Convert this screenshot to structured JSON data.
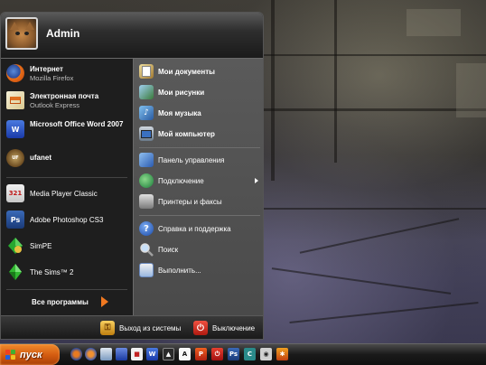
{
  "user": {
    "name": "Admin"
  },
  "pinned": [
    {
      "id": "internet",
      "title": "Интернет",
      "subtitle": "Mozilla Firefox",
      "icon": "firefox-icon"
    },
    {
      "id": "email",
      "title": "Электронная почта",
      "subtitle": "Outlook Express",
      "icon": "outlook-icon"
    },
    {
      "id": "word",
      "title": "Microsoft Office Word 2007",
      "icon": "word-icon"
    },
    {
      "id": "ufanet",
      "title": "ufanet",
      "icon": "ufanet-icon"
    }
  ],
  "recent": [
    {
      "id": "mpc",
      "title": "Media Player Classic",
      "icon": "media-player-icon",
      "badge": "321"
    },
    {
      "id": "photoshop",
      "title": "Adobe Photoshop CS3",
      "icon": "photoshop-icon",
      "badge": "Ps"
    },
    {
      "id": "simpe",
      "title": "SimPE",
      "icon": "simpe-icon"
    },
    {
      "id": "sims2",
      "title": "The Sims™ 2",
      "icon": "sims-icon"
    }
  ],
  "all_programs": "Все программы",
  "places": [
    {
      "id": "my-documents",
      "title": "Мои документы",
      "icon": "documents-icon"
    },
    {
      "id": "my-pictures",
      "title": "Мои рисунки",
      "icon": "pictures-icon"
    },
    {
      "id": "my-music",
      "title": "Моя музыка",
      "icon": "music-icon"
    },
    {
      "id": "my-computer",
      "title": "Мой компьютер",
      "icon": "computer-icon"
    }
  ],
  "settings": [
    {
      "id": "control-panel",
      "title": "Панель управления",
      "icon": "control-panel-icon"
    },
    {
      "id": "connect",
      "title": "Подключение",
      "icon": "network-icon",
      "submenu": true
    },
    {
      "id": "printers",
      "title": "Принтеры и факсы",
      "icon": "printer-icon"
    }
  ],
  "tools": [
    {
      "id": "help",
      "title": "Справка и поддержка",
      "icon": "help-icon"
    },
    {
      "id": "search",
      "title": "Поиск",
      "icon": "search-icon"
    },
    {
      "id": "run",
      "title": "Выполнить...",
      "icon": "run-icon"
    }
  ],
  "footer": {
    "logoff": "Выход из системы",
    "shutdown": "Выключение"
  },
  "taskbar": {
    "start_label": "пуск",
    "quick_launch": [
      "firefox-icon",
      "firefox-icon",
      "explorer-icon",
      "save-icon",
      "document-icon",
      "word-icon",
      "font-icon",
      "pdf-icon",
      "acrobat-icon",
      "photoshop-icon",
      "gear-icon",
      "camera-icon",
      "sims-icon"
    ]
  },
  "colors": {
    "start_button": "#d25a10",
    "menu_left": "#1e1e1e",
    "menu_right": "#4f4f4f",
    "shutdown": "#d32a1a",
    "logoff": "#e0a020"
  }
}
